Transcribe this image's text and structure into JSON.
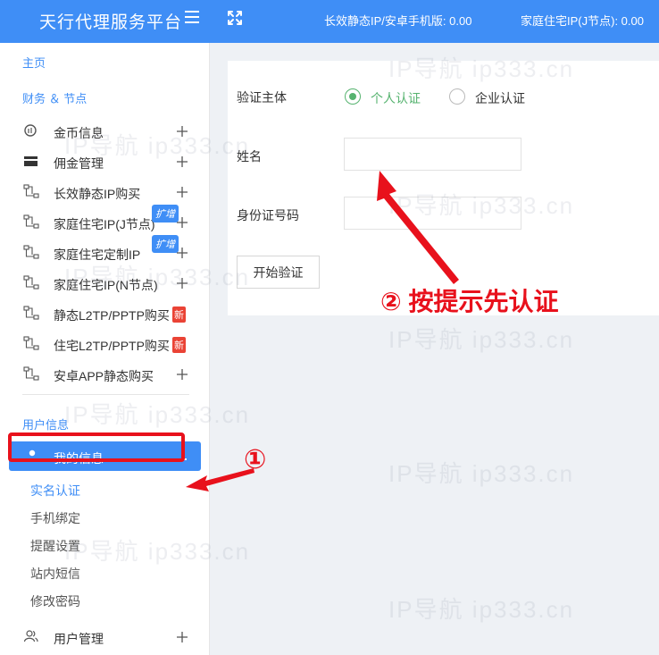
{
  "header": {
    "brand": "天行代理服务平台",
    "status_static": "长效静态IP/安卓手机版: 0.00",
    "status_home": "家庭住宅IP(J节点): 0.00"
  },
  "sidebar": {
    "home": "主页",
    "finance_title": "财务 ＆ 节点",
    "items": [
      {
        "label": "金币信息"
      },
      {
        "label": "佣金管理"
      },
      {
        "label": "长效静态IP购买"
      },
      {
        "label": "家庭住宅IP(J节点)",
        "badge": "扩增"
      },
      {
        "label": "家庭住宅定制IP",
        "badge": "扩增"
      },
      {
        "label": "家庭住宅IP(N节点)"
      },
      {
        "label": "静态L2TP/PPTP购买",
        "badge": "新"
      },
      {
        "label": "住宅L2TP/PPTP购买",
        "badge": "新"
      },
      {
        "label": "安卓APP静态购买"
      }
    ],
    "user_title": "用户信息",
    "my_info": "我的信息",
    "sub_items": [
      "实名认证",
      "手机绑定",
      "提醒设置",
      "站内短信",
      "修改密码"
    ],
    "user_mgmt": "用户管理"
  },
  "form": {
    "subject_label": "验证主体",
    "option_personal": "个人认证",
    "option_enterprise": "企业认证",
    "name_label": "姓名",
    "name_value": "",
    "id_label": "身份证号码",
    "id_value": "",
    "submit": "开始验证"
  },
  "watermark": "IP导航  ip333.cn",
  "annotations": {
    "step1": "①",
    "step2": "② 按提示先认证"
  },
  "colors": {
    "primary": "#3f8ef6",
    "annotation": "#e8111c",
    "radio_on": "#56b36f",
    "badge_new": "#ea4335"
  }
}
